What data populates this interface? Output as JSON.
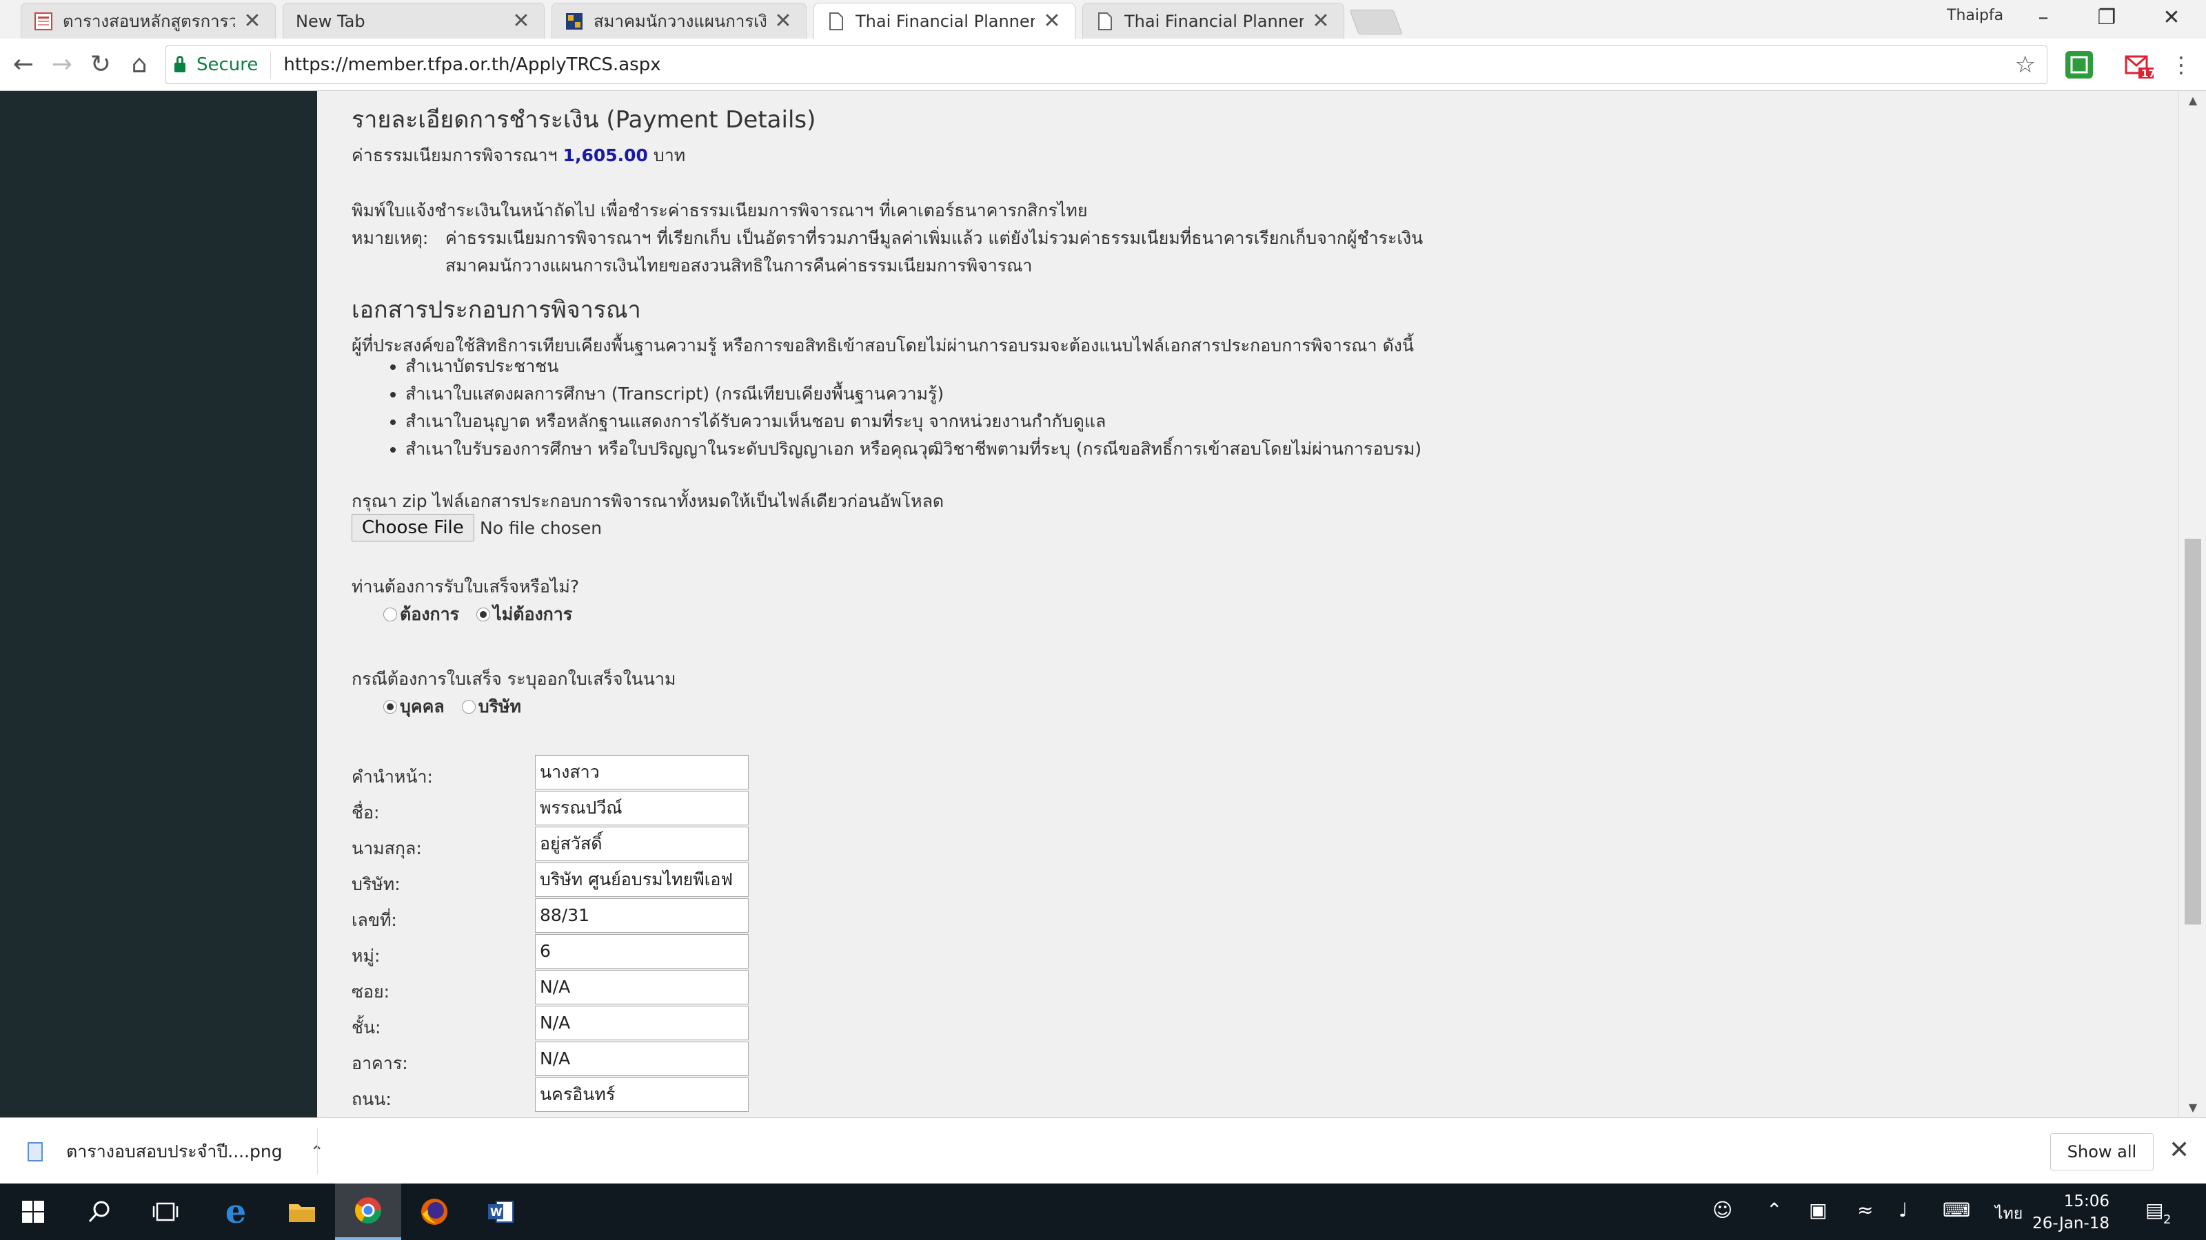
{
  "browser": {
    "tabs": [
      {
        "title": "ตารางสอบหลักสูตรการวางแผน",
        "active": false,
        "favicon": "image-favicon"
      },
      {
        "title": "New Tab",
        "active": false,
        "favicon": "none"
      },
      {
        "title": "สมาคมนักวางแผนการเงินไทย",
        "active": false,
        "favicon": "site-favicon"
      },
      {
        "title": "Thai Financial Planners A",
        "active": true,
        "favicon": "page-icon"
      },
      {
        "title": "Thai Financial Planners A",
        "active": false,
        "favicon": "page-icon"
      }
    ],
    "tab_close": "✕",
    "profile": "Thaipfa",
    "secure_label": "Secure",
    "url": "https://member.tfpa.or.th/ApplyTRCS.aspx",
    "gmail_badge": "17"
  },
  "payment": {
    "heading": "รายละเอียดการชำระเงิน (Payment Details)",
    "fee_prefix": "ค่าธรรมเนียมการพิจารณาฯ",
    "fee_amount": "1,605.00",
    "fee_unit": "บาท",
    "instruction": "พิมพ์ใบแจ้งชำระเงินในหน้าถัดไป เพื่อชำระค่าธรรมเนียมการพิจารณาฯ ที่เคาเตอร์ธนาคารกสิกรไทย",
    "note_label": "หมายเหตุ:",
    "note_line1": "ค่าธรรมเนียมการพิจารณาฯ ที่เรียกเก็บ เป็นอัตราที่รวมภาษีมูลค่าเพิ่มแล้ว แต่ยังไม่รวมค่าธรรมเนียมที่ธนาคารเรียกเก็บจากผู้ชำระเงิน",
    "note_line2": "สมาคมนักวางแผนการเงินไทยขอสงวนสิทธิในการคืนค่าธรรมเนียมการพิจารณา"
  },
  "documents": {
    "heading": "เอกสารประกอบการพิจารณา",
    "intro": "ผู้ที่ประสงค์ขอใช้สิทธิการเทียบเคียงพื้นฐานความรู้ หรือการขอสิทธิเข้าสอบโดยไม่ผ่านการอบรมจะต้องแนบไฟล์เอกสารประกอบการพิจารณา ดังนี้",
    "items": [
      "สำเนาบัตรประชาชน",
      "สำเนาใบแสดงผลการศึกษา (Transcript) (กรณีเทียบเคียงพื้นฐานความรู้)",
      "สำเนาใบอนุญาต หรือหลักฐานแสดงการได้รับความเห็นชอบ ตามที่ระบุ จากหน่วยงานกำกับดูแล",
      "สำเนาใบรับรองการศึกษา หรือใบปริญญาในระดับปริญญาเอก หรือคุณวุฒิวิชาชีพตามที่ระบุ (กรณีขอสิทธิ์การเข้าสอบโดยไม่ผ่านการอบรม)"
    ],
    "zip_note": "กรุณา zip ไฟล์เอกสารประกอบการพิจารณาทั้งหมดให้เป็นไฟล์เดียวก่อนอัพโหลด",
    "choose_file": "Choose File",
    "no_file": "No file chosen"
  },
  "receipt": {
    "question": "ท่านต้องการรับใบเสร็จหรือไม่?",
    "opt_yes": "ต้องการ",
    "opt_no": "ไม่ต้องการ",
    "selected": "no",
    "name_question": "กรณีต้องการใบเสร็จ ระบุออกใบเสร็จในนาม",
    "opt_person": "บุคคล",
    "opt_company": "บริษัท",
    "name_selected": "person"
  },
  "form": {
    "fields": [
      {
        "label": "คำนำหน้า:",
        "value": "นางสาว"
      },
      {
        "label": "ชื่อ:",
        "value": "พรรณปวีณ์"
      },
      {
        "label": "นามสกุล:",
        "value": "อยู่สวัสดิ์"
      },
      {
        "label": "บริษัท:",
        "value": "บริษัท ศูนย์อบรมไทยพีเอฟ"
      },
      {
        "label": "เลขที่:",
        "value": "88/31"
      },
      {
        "label": "หมู่:",
        "value": "6"
      },
      {
        "label": "ซอย:",
        "value": "N/A"
      },
      {
        "label": "ชั้น:",
        "value": "N/A"
      },
      {
        "label": "อาคาร:",
        "value": "N/A"
      },
      {
        "label": "ถนน:",
        "value": "นครอินทร์"
      }
    ]
  },
  "downloads": {
    "file_name": "ตารางอบสอบประจำปี....png",
    "show_all": "Show all"
  },
  "taskbar": {
    "lang": "ไทย",
    "time": "15:06",
    "date": "26-Jan-18",
    "notif_count": "2"
  }
}
